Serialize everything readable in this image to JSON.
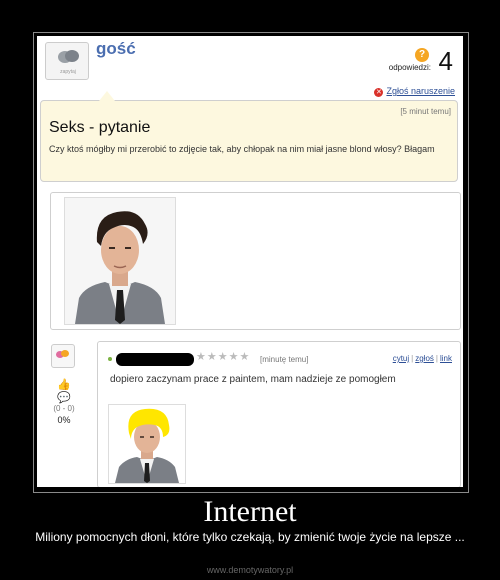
{
  "post": {
    "username": "gość",
    "logo_text": "zapytaj",
    "answers_label": "odpowiedzi:",
    "answers_count": "4",
    "report_label": "Zgłoś naruszenie",
    "question": {
      "time": "[5 minut temu]",
      "title": "Seks - pytanie",
      "body": "Czy ktoś mógłby mi przerobić to zdjęcie tak, aby chłopak na nim miał jasne blond włosy? Błagam"
    },
    "answer": {
      "stars": "★★★★★",
      "time": "[minutę temu]",
      "actions": [
        "cytuj",
        "zgłoś",
        "link"
      ],
      "text": "dopiero zaczynam prace z paintem, mam nadzieje ze pomogłem",
      "votes": "(0 - 0)",
      "percent": "0%"
    }
  },
  "caption": {
    "title": "Internet",
    "subtitle": "Miliony pomocnych dłoni, które tylko czekają, by zmienić twoje życie na lepsze ...",
    "site": "www.demotywatory.pl"
  }
}
